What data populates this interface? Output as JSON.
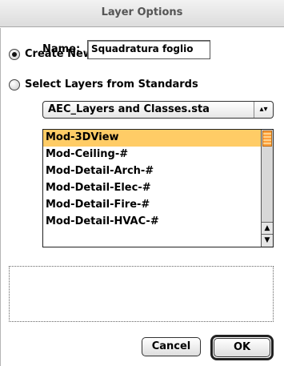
{
  "window": {
    "title": "Layer Options"
  },
  "create_option": {
    "label": "Create New Layer",
    "checked": true
  },
  "name_field": {
    "label": "Name:",
    "value": "Squadratura foglio"
  },
  "standards_option": {
    "label": "Select Layers from Standards",
    "checked": false
  },
  "standards_popup": {
    "selected": "AEC_Layers and Classes.sta",
    "arrow": "▴▾"
  },
  "layer_list": {
    "items": [
      "Mod-3DView",
      "Mod-Ceiling-#",
      "Mod-Detail-Arch-#",
      "Mod-Detail-Elec-#",
      "Mod-Detail-Fire-#",
      "Mod-Detail-HVAC-#"
    ],
    "selected_index": 0
  },
  "description_box": {
    "text": ""
  },
  "buttons": {
    "cancel": "Cancel",
    "ok": "OK"
  },
  "colors": {
    "selection": "#ffcc66",
    "scroll_thumb": "#ff9f3a"
  },
  "icons": {
    "scroll_up": "▲",
    "scroll_down": "▼"
  }
}
